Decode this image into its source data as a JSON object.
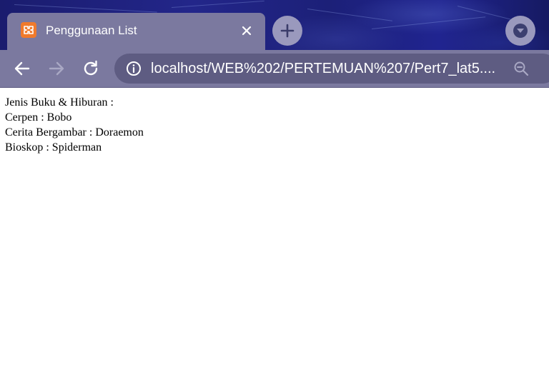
{
  "browser": {
    "tab": {
      "title": "Penggunaan List",
      "favicon": "xampp-logo-icon",
      "favicon_color": "#f07a2c"
    },
    "toolbar": {
      "back": "back-arrow-icon",
      "forward": "forward-arrow-icon",
      "reload": "reload-icon",
      "address": {
        "security_icon": "info-icon",
        "url": "localhost/WEB%202/PERTEMUAN%207/Pert7_lat5....",
        "zoom_icon": "zoom-out-icon"
      }
    },
    "colors": {
      "frame": "#7b799f",
      "omnibox": "#5e5c82",
      "wallpaper": "#1e2282"
    }
  },
  "page": {
    "lines": [
      "Jenis Buku & Hiburan :",
      "Cerpen : Bobo",
      "Cerita Bergambar : Doraemon",
      "Bioskop : Spiderman"
    ]
  }
}
